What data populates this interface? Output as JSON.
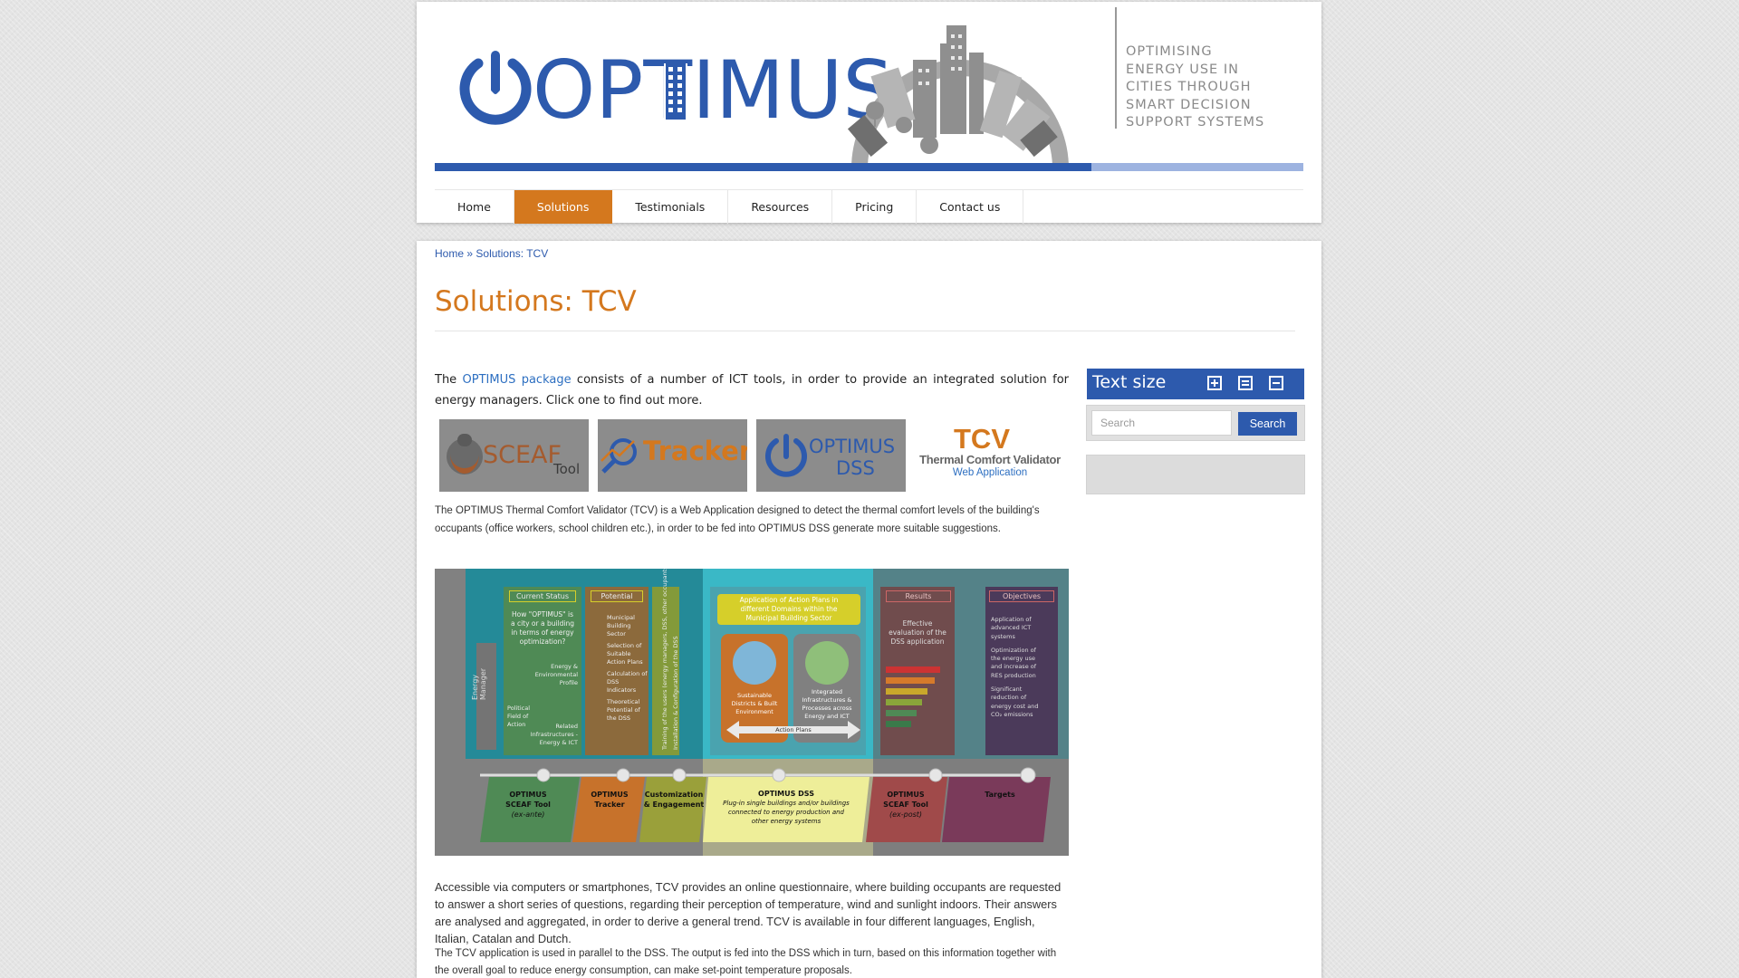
{
  "header": {
    "logo": "OPTIMUS",
    "tagline": [
      "OPTIMISING",
      "ENERGY USE IN",
      "CITIES THROUGH",
      "SMART DECISION",
      "SUPPORT SYSTEMS"
    ],
    "brand_color": "#2d5aad",
    "accent_color": "#d4781e"
  },
  "nav": {
    "items": [
      {
        "label": "Home",
        "active": false
      },
      {
        "label": "Solutions",
        "active": true
      },
      {
        "label": "Testimonials",
        "active": false
      },
      {
        "label": "Resources",
        "active": false
      },
      {
        "label": "Pricing",
        "active": false
      },
      {
        "label": "Contact us",
        "active": false
      }
    ]
  },
  "breadcrumb": {
    "home": "Home",
    "separator": "»",
    "current": "Solutions: TCV"
  },
  "page": {
    "title": "Solutions: TCV",
    "intro_before": "The ",
    "intro_link": "OPTIMUS package",
    "intro_after": " consists of a number of ICT tools, in order to provide an integrated solution for energy managers. Click one to find out more.",
    "tcv_description": "The OPTIMUS Thermal Comfort Validator (TCV) is a Web Application designed to detect the thermal comfort levels of the building's occupants (office workers, school children etc.), in order to be fed into OPTIMUS DSS generate more suitable suggestions.",
    "paragraph2": "Accessible via computers or smartphones, TCV provides an online questionnaire, where building occupants are requested to answer a short series of questions, regarding their perception of temperature, wind and sunlight indoors. Their answers are analysed and aggregated, in order to derive a general trend. TCV is available in four different languages, English, Italian, Catalan and Dutch.",
    "paragraph3": "The TCV application is used in parallel to the DSS. The output is fed into the DSS which in turn, based on this information together with the overall goal to reduce energy consumption, can make set-point temperature proposals."
  },
  "tools": {
    "sceaf": {
      "main": "SCEAF",
      "sub": "Tool"
    },
    "tracker": {
      "main": "Tracker"
    },
    "dss": {
      "line1": "OPTIMUS",
      "line2": "DSS"
    },
    "tcv": {
      "abbr": "TCV",
      "name": "Thermal Comfort Validator",
      "sub": "Web Application"
    }
  },
  "diagram": {
    "side_label": "Energy Manager",
    "col_current_status": "Current Status",
    "current_status_text": [
      "How \"OPTIMUS\" is",
      "a city or a building",
      "in terms of energy",
      "optimization?"
    ],
    "current_labels": [
      "Energy &",
      "Environmental",
      "Profile",
      "Political",
      "Field of",
      "Action",
      "Related",
      "Infrastructures -",
      "Energy & ICT"
    ],
    "col_potential": "Potential",
    "potential_text": [
      "Municipal",
      "Building",
      "Sector",
      "Selection of",
      "Suitable",
      "Action Plans",
      "Calculation of",
      "DSS",
      "Indicators",
      "Theoretical",
      "Potential of",
      "the DSS"
    ],
    "vertical_1": "Training of the users (energy managers, DSS, other occupants)",
    "vertical_2": "Installation & Configuration of the DSS",
    "application_title": [
      "Application of Action Plans in",
      "different Domains within the",
      "Municipal Building Sector"
    ],
    "box1": [
      "Sustainable",
      "Districts & Built",
      "Environment"
    ],
    "box2": [
      "Integrated",
      "Infrastructures &",
      "Processes across",
      "Energy and ICT"
    ],
    "action_plans": "Action Plans",
    "col_results": "Results",
    "results_text": [
      "Effective",
      "evaluation of the",
      "DSS application"
    ],
    "col_objectives": "Objectives",
    "objectives_text": [
      "Application of",
      "advanced ICT",
      "systems",
      "Optimization of",
      "the energy use",
      "and increase of",
      "RES production",
      "Significant",
      "reduction of",
      "energy cost and",
      "CO₂ emissions"
    ],
    "bottom": [
      {
        "l1": "OPTIMUS",
        "l2": "SCEAF Tool",
        "l3": "(ex-ante)"
      },
      {
        "l1": "OPTIMUS",
        "l2": "Tracker",
        "l3": ""
      },
      {
        "l1": "Customization",
        "l2": "& Engagement",
        "l3": ""
      },
      {
        "l1": "OPTIMUS DSS",
        "l2": "Plug-in single buildings and/or buildings",
        "l3": "connected to energy production and",
        "l4": "other energy systems"
      },
      {
        "l1": "OPTIMUS",
        "l2": "SCEAF Tool",
        "l3": "(ex-post)"
      },
      {
        "l1": "Targets",
        "l2": "",
        "l3": ""
      }
    ]
  },
  "sidebar": {
    "text_size_label": "Text size",
    "search_placeholder": "Search",
    "search_button": "Search"
  }
}
